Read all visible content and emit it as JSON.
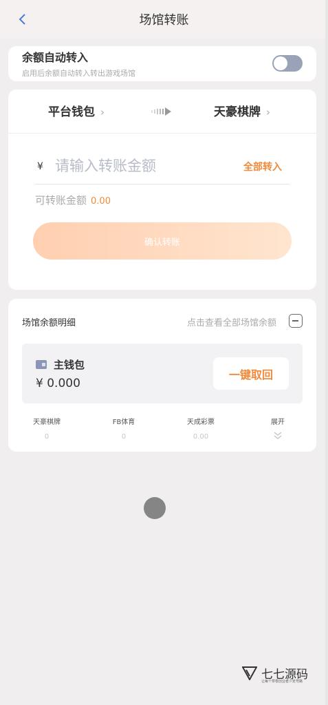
{
  "header": {
    "title": "场馆转账",
    "back_icon": "chevron-left-icon"
  },
  "auto_transfer": {
    "title": "余额自动转入",
    "subtitle": "启用后余额自动转入转出游戏场馆",
    "enabled": false
  },
  "transfer": {
    "from_wallet": "平台钱包",
    "to_wallet": "天豪棋牌",
    "currency_symbol": "¥",
    "amount_placeholder": "请输入转账金额",
    "all_in_label": "全部转入",
    "available_label": "可转账金额",
    "available_value": "0.00",
    "confirm_label": "确认转账"
  },
  "detail": {
    "title": "场馆余额明细",
    "view_all_link": "点击查看全部场馆余额",
    "main_wallet_label": "主钱包",
    "main_wallet_value": "¥ 0.000",
    "recall_label": "一键取回",
    "venues": [
      {
        "name": "天豪棋牌",
        "value": "0"
      },
      {
        "name": "FB体育",
        "value": "0"
      },
      {
        "name": "天成彩票",
        "value": "0.00"
      }
    ],
    "expand_label": "展开"
  },
  "watermark": {
    "brand": "七七源码",
    "tagline": "让每个草根创业者少走弯路"
  },
  "colors": {
    "accent": "#f08a3c",
    "toggle_off": "#9aa2b8",
    "confirm_gradient_start": "#ffcfb0",
    "confirm_gradient_end": "#ffe5cf"
  }
}
